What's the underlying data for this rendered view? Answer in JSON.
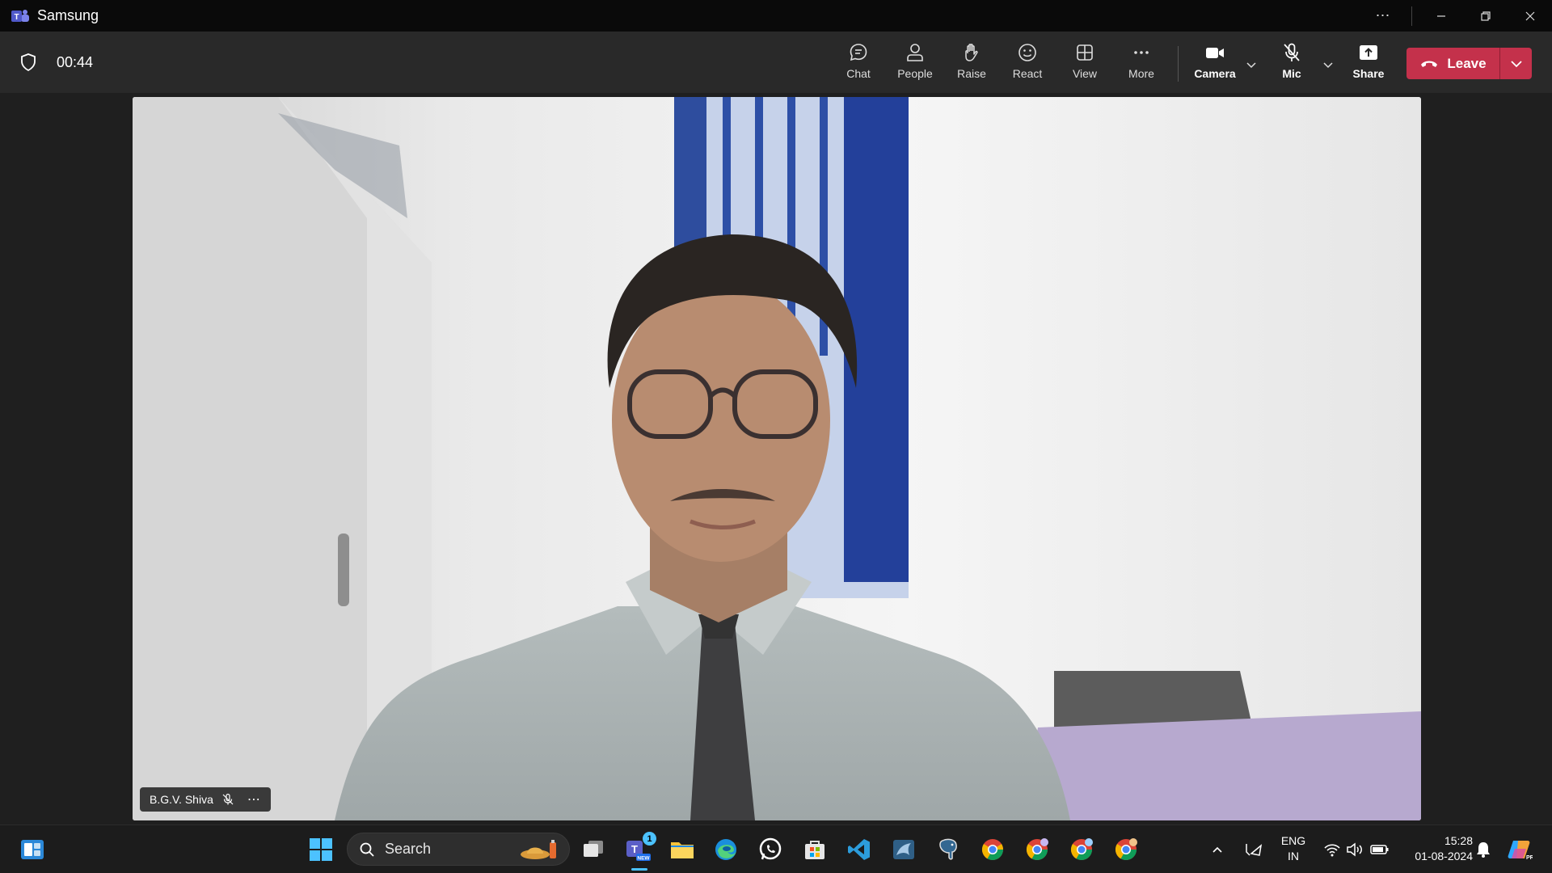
{
  "window": {
    "title": "Samsung"
  },
  "meeting": {
    "timer": "00:44"
  },
  "toolbar": {
    "chat": "Chat",
    "people": "People",
    "raise": "Raise",
    "react": "React",
    "view": "View",
    "more": "More",
    "camera": "Camera",
    "mic": "Mic",
    "share": "Share",
    "leave": "Leave"
  },
  "participant": {
    "name": "B.G.V. Shiva"
  },
  "taskbar": {
    "search_label": "Search",
    "teams_badge": "1",
    "language_top": "ENG",
    "language_bottom": "IN",
    "time": "15:28",
    "date": "01-08-2024"
  }
}
